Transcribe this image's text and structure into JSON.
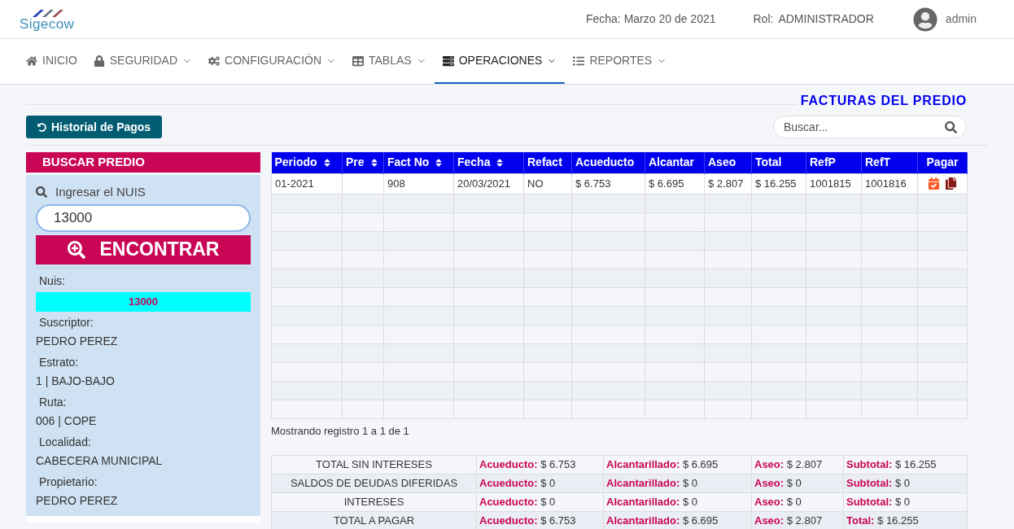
{
  "header": {
    "logo": "Sigecow",
    "date": "Fecha: Marzo 20 de 2021",
    "role_label": "Rol:",
    "role": "ADMINISTRADOR",
    "user": "admin"
  },
  "nav": [
    {
      "label": "INICIO",
      "has_menu": false,
      "selected": false
    },
    {
      "label": "SEGURIDAD",
      "has_menu": true,
      "selected": false
    },
    {
      "label": "CONFIGURACIÓN",
      "has_menu": true,
      "selected": false
    },
    {
      "label": "TABLAS",
      "has_menu": true,
      "selected": false
    },
    {
      "label": "OPERACIONES",
      "has_menu": true,
      "selected": true
    },
    {
      "label": "REPORTES",
      "has_menu": true,
      "selected": false
    }
  ],
  "section_title": "FACTURAS DEL PREDIO",
  "history_button": "Historial de Pagos",
  "search": {
    "placeholder": "Buscar..."
  },
  "panel": {
    "title": "BUSCAR PREDIO",
    "input_label": "Ingresar el NUIS",
    "input_value": "13000",
    "find_button": "ENCONTRAR",
    "nuis_label": "Nuis:",
    "nuis_value": "13000",
    "fields": [
      {
        "label": "Suscriptor:",
        "value": "PEDRO PEREZ"
      },
      {
        "label": "Estrato:",
        "value": "1 | BAJO-BAJO"
      },
      {
        "label": "Ruta:",
        "value": "006 | COPE"
      },
      {
        "label": "Localidad:",
        "value": "CABECERA MUNICIPAL"
      },
      {
        "label": "Propietario:",
        "value": "PEDRO PEREZ"
      }
    ]
  },
  "table": {
    "columns": [
      {
        "label": "Periodo",
        "sortable": true
      },
      {
        "label": "Pre",
        "sortable": true
      },
      {
        "label": "Fact No",
        "sortable": true
      },
      {
        "label": "Fecha",
        "sortable": true
      },
      {
        "label": "Refact",
        "sortable": false
      },
      {
        "label": "Acueducto",
        "sortable": false
      },
      {
        "label": "Alcantar",
        "sortable": false
      },
      {
        "label": "Aseo",
        "sortable": false
      },
      {
        "label": "Total",
        "sortable": false
      },
      {
        "label": "RefP",
        "sortable": false
      },
      {
        "label": "RefT",
        "sortable": false
      },
      {
        "label": "Pagar",
        "sortable": false
      }
    ],
    "rows": [
      [
        "01-2021",
        "",
        "908",
        "20/03/2021",
        "NO",
        "$ 6.753",
        "$ 6.695",
        "$ 2.807",
        "$ 16.255",
        "1001815",
        "1001816"
      ]
    ],
    "footer": "Mostrando registro 1 a 1 de 1"
  },
  "summary": [
    {
      "label": "TOTAL SIN INTERESES",
      "cells": [
        {
          "label": "Acueducto:",
          "value": "$ 6.753"
        },
        {
          "label": "Alcantarillado:",
          "value": "$ 6.695"
        },
        {
          "label": "Aseo:",
          "value": "$ 2.807"
        },
        {
          "label": "Subtotal:",
          "value": "$ 16.255"
        }
      ]
    },
    {
      "label": "SALDOS DE DEUDAS DIFERIDAS",
      "cells": [
        {
          "label": "Acueducto:",
          "value": "$ 0"
        },
        {
          "label": "Alcantarillado:",
          "value": "$ 0"
        },
        {
          "label": "Aseo:",
          "value": "$ 0"
        },
        {
          "label": "Subtotal:",
          "value": "$ 0"
        }
      ]
    },
    {
      "label": "INTERESES",
      "cells": [
        {
          "label": "Acueducto:",
          "value": "$ 0"
        },
        {
          "label": "Alcantarillado:",
          "value": "$ 0"
        },
        {
          "label": "Aseo:",
          "value": "$ 0"
        },
        {
          "label": "Subtotal:",
          "value": "$ 0"
        }
      ]
    },
    {
      "label": "TOTAL A PAGAR",
      "cells": [
        {
          "label": "Acueducto:",
          "value": "$ 6.753"
        },
        {
          "label": "Alcantarillado:",
          "value": "$ 6.695"
        },
        {
          "label": "Aseo:",
          "value": "$ 2.807"
        },
        {
          "label": "Total:",
          "value": "$ 16.255"
        }
      ]
    }
  ]
}
